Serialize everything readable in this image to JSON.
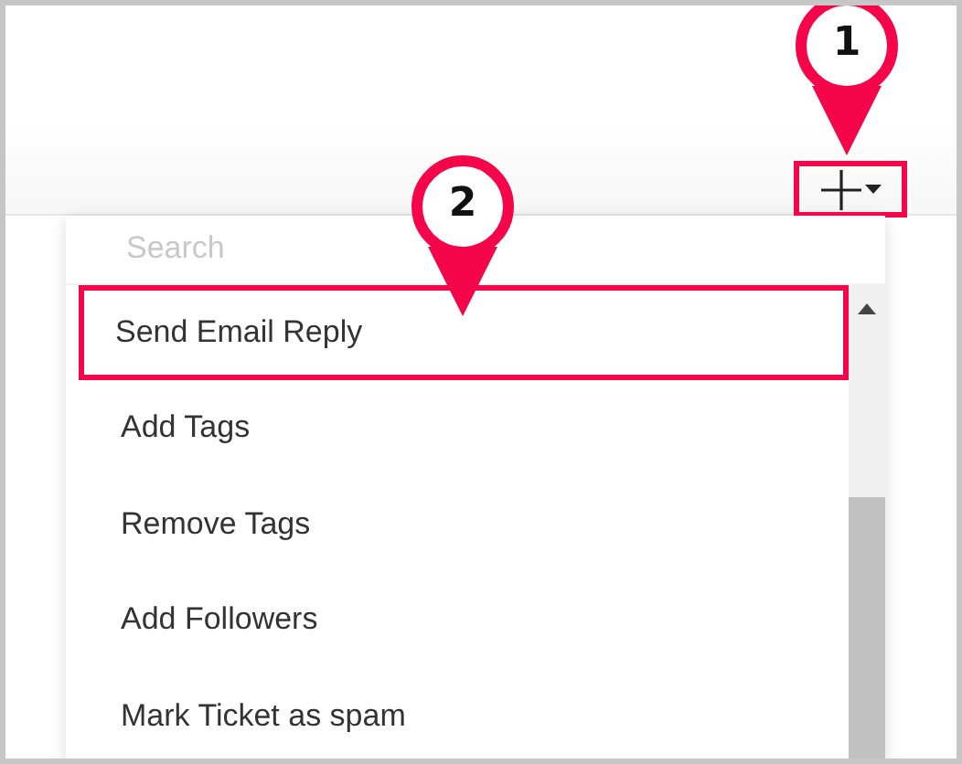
{
  "toolbar": {
    "add_button": {
      "highlighted": true
    }
  },
  "menu": {
    "search": {
      "placeholder": "Search"
    },
    "items": [
      {
        "label": "Send Email Reply",
        "highlighted": true
      },
      {
        "label": "Add Tags",
        "highlighted": false
      },
      {
        "label": "Remove Tags",
        "highlighted": false
      },
      {
        "label": "Add Followers",
        "highlighted": false
      },
      {
        "label": "Mark Ticket as spam",
        "highlighted": false
      }
    ]
  },
  "callouts": [
    {
      "number": "1"
    },
    {
      "number": "2"
    }
  ]
}
